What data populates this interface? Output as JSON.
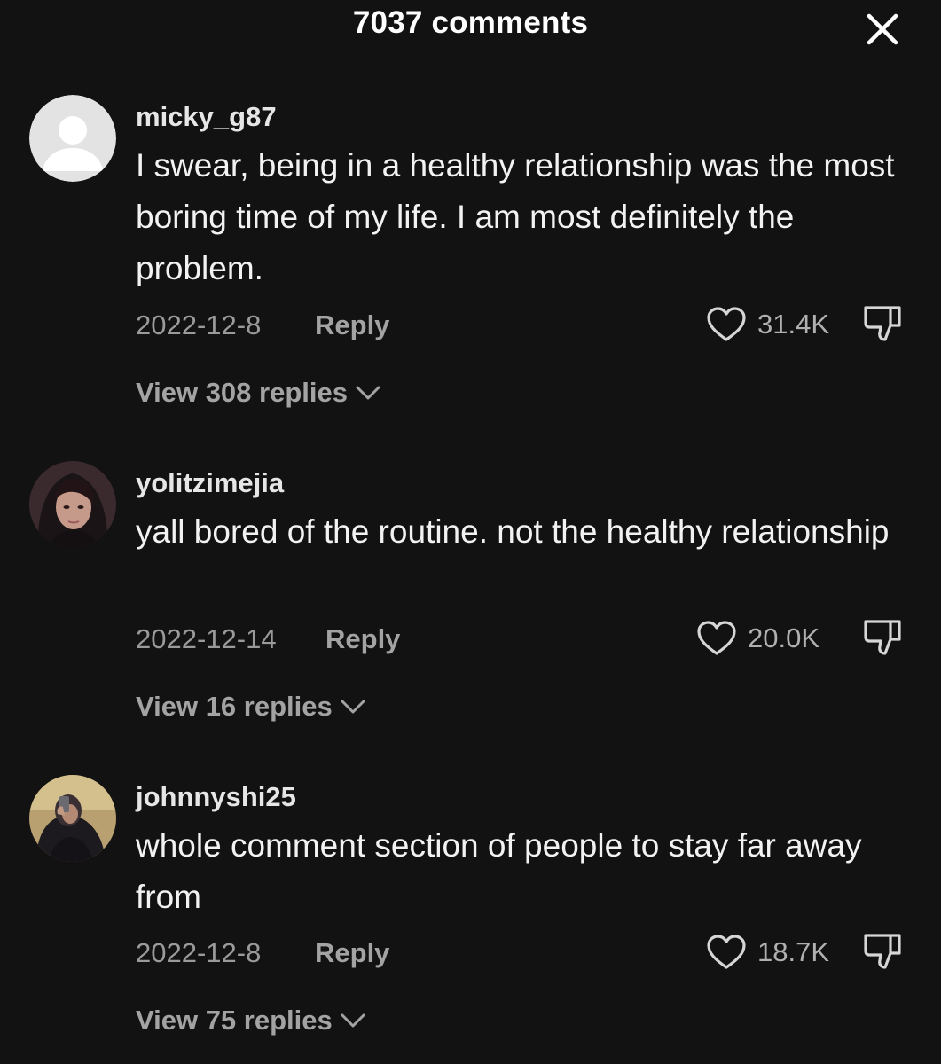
{
  "header": {
    "title": "7037 comments",
    "close_icon": "close-icon"
  },
  "comments": [
    {
      "username": "micky_g87",
      "text": "I swear, being in a healthy relationship was the most boring time of my life. I am most definitely the problem.",
      "date": "2022-12-8",
      "reply_label": "Reply",
      "likes": "31.4K",
      "view_replies": "View 308 replies",
      "avatar": "default-avatar-icon"
    },
    {
      "username": "yolitzimejia",
      "text": "yall bored of the routine. not the healthy relationship",
      "date": "2022-12-14",
      "reply_label": "Reply",
      "likes": "20.0K",
      "view_replies": "View 16 replies",
      "avatar": "profile-photo"
    },
    {
      "username": "johnnyshi25",
      "text": "whole comment section of people to stay far away from",
      "date": "2022-12-8",
      "reply_label": "Reply",
      "likes": "18.7K",
      "view_replies": "View 75 replies",
      "avatar": "profile-photo"
    }
  ],
  "icons": {
    "like": "heart-outline-icon",
    "dislike": "thumbs-down-icon",
    "expand": "chevron-down-icon"
  },
  "colors": {
    "background": "#121212",
    "primary_text": "#f2f2f2",
    "secondary_text": "#9a9a9a"
  }
}
